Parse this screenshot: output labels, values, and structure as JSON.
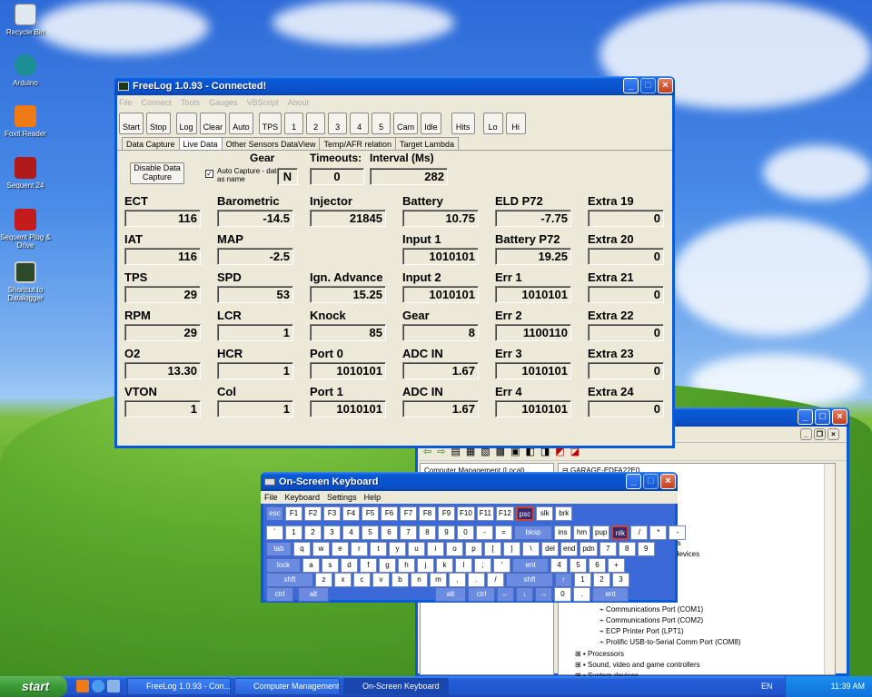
{
  "desktop": {
    "icons": [
      {
        "label": "Recycle Bin"
      },
      {
        "label": "Arduino"
      },
      {
        "label": "Foxit Reader"
      },
      {
        "label": "Sequent 24"
      },
      {
        "label": "Sequent Plug & Drive"
      },
      {
        "label": "Shortcut to Datalogger"
      }
    ]
  },
  "freelog": {
    "title": "FreeLog 1.0.93 - Connected!",
    "menu": [
      "File",
      "Connect",
      "Tools",
      "Gauges",
      "VBScript",
      "About"
    ],
    "toolbar": [
      "Start",
      "Stop",
      "Log",
      "Clear",
      "Auto",
      "TPS",
      "1",
      "2",
      "3",
      "4",
      "5",
      "Cam",
      "Idle",
      "Hits",
      "Lo",
      "Hi"
    ],
    "tabs": [
      "Data Capture",
      "Live Data",
      "Other Sensors DataView",
      "Temp/AFR relation",
      "Target Lambda"
    ],
    "disable_btn": "Disable Data Capture",
    "auto_capture": "Auto Capture - date as name",
    "gear_label": "Gear",
    "gear_value": "N",
    "timeouts_label": "Timeouts:",
    "timeouts_value": "0",
    "interval_label": "Interval (Ms)",
    "interval_value": "282",
    "fields": [
      {
        "label": "ECT",
        "value": "116"
      },
      {
        "label": "Barometric",
        "value": "-14.5"
      },
      {
        "label": "Injector",
        "value": "21845"
      },
      {
        "label": "Battery",
        "value": "10.75"
      },
      {
        "label": "ELD P72",
        "value": "-7.75"
      },
      {
        "label": "Extra 19",
        "value": "0"
      },
      {
        "label": "IAT",
        "value": "116"
      },
      {
        "label": "MAP",
        "value": "-2.5"
      },
      {
        "label": "Input 1",
        "value": "1010101"
      },
      {
        "label": "Battery P72",
        "value": "19.25"
      },
      {
        "label": "Extra 20",
        "value": "0"
      },
      {
        "label": "TPS",
        "value": "29"
      },
      {
        "label": "SPD",
        "value": "53"
      },
      {
        "label": "Ign. Advance",
        "value": "15.25"
      },
      {
        "label": "Input 2",
        "value": "1010101"
      },
      {
        "label": "Err 1",
        "value": "1010101"
      },
      {
        "label": "Extra 21",
        "value": "0"
      },
      {
        "label": "RPM",
        "value": "29"
      },
      {
        "label": "LCR",
        "value": "1"
      },
      {
        "label": "Knock",
        "value": "85"
      },
      {
        "label": "Gear",
        "value": "8"
      },
      {
        "label": "Err 2",
        "value": "1100110"
      },
      {
        "label": "Extra 22",
        "value": "0"
      },
      {
        "label": "O2",
        "value": "13.30"
      },
      {
        "label": "HCR",
        "value": "1"
      },
      {
        "label": "Port 0",
        "value": "1010101"
      },
      {
        "label": "ADC IN",
        "value": "1.67"
      },
      {
        "label": "Err 3",
        "value": "1010101"
      },
      {
        "label": "Extra 23",
        "value": "0"
      },
      {
        "label": "VTON",
        "value": "1"
      },
      {
        "label": "Col",
        "value": "1"
      },
      {
        "label": "Port 1",
        "value": "1010101"
      },
      {
        "label": "ADC IN",
        "value": "1.67"
      },
      {
        "label": "Err 4",
        "value": "1010101"
      },
      {
        "label": "Extra 24",
        "value": "0"
      }
    ]
  },
  "compmgmt": {
    "tree_root": "Computer Management (Local)",
    "device_root": "GARAGE-EDFA22E0",
    "items": [
      "Communications Port (COM1)",
      "Communications Port (COM2)",
      "ECP Printer Port (LPT1)",
      "Prolific USB-to-Serial Comm Port (COM8)",
      "Processors",
      "Sound, video and game controllers",
      "System devices"
    ],
    "partial": [
      "s",
      "rs",
      "devices"
    ]
  },
  "osk": {
    "title": "On-Screen Keyboard",
    "menu": [
      "File",
      "Keyboard",
      "Settings",
      "Help"
    ],
    "rows": [
      [
        "esc",
        "F1",
        "F2",
        "F3",
        "F4",
        "F5",
        "F6",
        "F7",
        "F8",
        "F9",
        "F10",
        "F11",
        "F12",
        "psc",
        "slk",
        "brk"
      ],
      [
        "`",
        "1",
        "2",
        "3",
        "4",
        "5",
        "6",
        "7",
        "8",
        "9",
        "0",
        "-",
        "=",
        "bksp",
        "ins",
        "hm",
        "pup",
        "nlk",
        "/",
        "*",
        "-"
      ],
      [
        "tab",
        "q",
        "w",
        "e",
        "r",
        "t",
        "y",
        "u",
        "i",
        "o",
        "p",
        "[",
        "]",
        "\\",
        "del",
        "end",
        "pdn",
        "7",
        "8",
        "9"
      ],
      [
        "lock",
        "a",
        "s",
        "d",
        "f",
        "g",
        "h",
        "j",
        "k",
        "l",
        ";",
        "'",
        "ent",
        "4",
        "5",
        "6",
        "+"
      ],
      [
        "shft",
        "z",
        "x",
        "c",
        "v",
        "b",
        "n",
        "m",
        ",",
        ".",
        "/",
        "shft",
        "↑",
        "1",
        "2",
        "3"
      ],
      [
        "ctrl",
        "alt",
        "alt",
        "ctrl",
        "←",
        "↓",
        "→",
        "0",
        ".",
        "ent"
      ]
    ]
  },
  "taskbar": {
    "start": "start",
    "tasks": [
      "FreeLog 1.0.93 - Con...",
      "Computer Management",
      "On-Screen Keyboard"
    ],
    "lang": "EN",
    "clock": "11:39 AM"
  }
}
